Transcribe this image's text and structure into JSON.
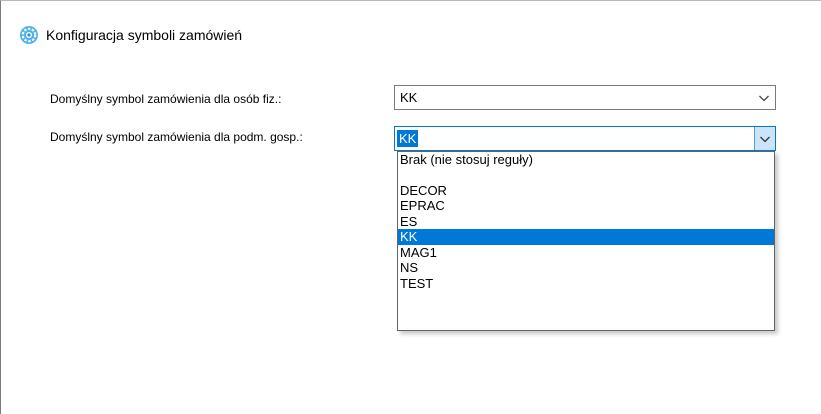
{
  "window": {
    "title": "Konfiguracja symboli zamówień",
    "icon": "gear-icon"
  },
  "form": {
    "row1": {
      "label": "Domyślny symbol zamówienia dla osób fiz.:",
      "value": "KK"
    },
    "row2": {
      "label": "Domyślny symbol zamówienia dla podm. gosp.:",
      "value": "KK"
    }
  },
  "dropdown": {
    "options": [
      "Brak (nie stosuj reguły)",
      "",
      "DECOR",
      "EPRAC",
      "ES",
      "KK",
      "MAG1",
      "NS",
      "TEST"
    ],
    "selected": "KK"
  },
  "colors": {
    "accent": "#0078d7",
    "button_hover": "#cce4f7"
  }
}
